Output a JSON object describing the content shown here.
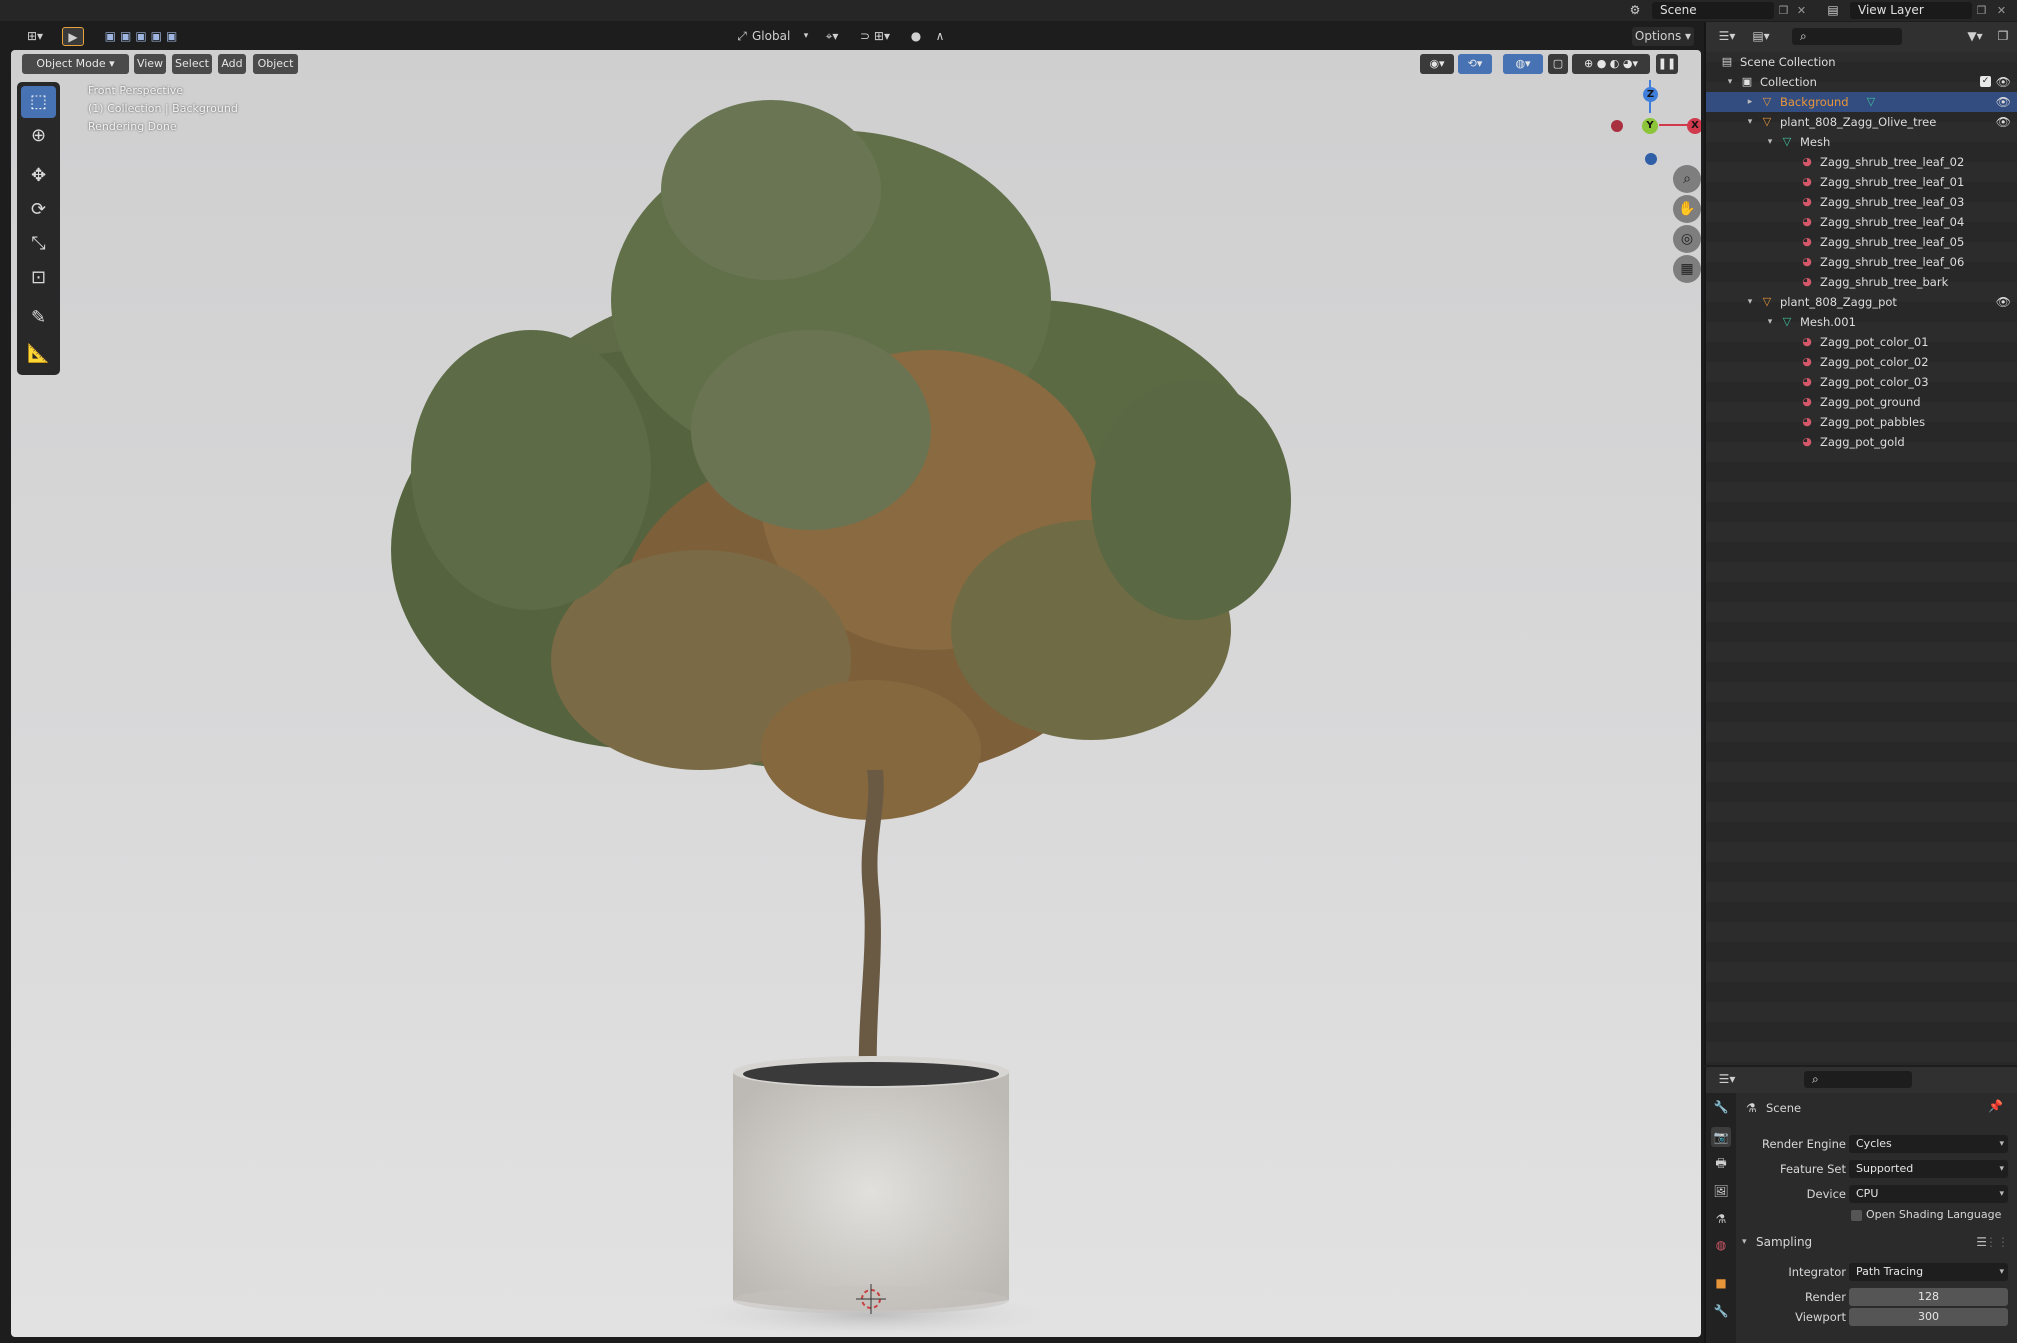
{
  "topbar": {
    "scene_label": "Scene",
    "view_layer_label": "View Layer"
  },
  "header": {
    "transform_orientation": "Global",
    "options_label": "Options"
  },
  "viewport": {
    "mode": "Object Mode",
    "menus": [
      "View",
      "Select",
      "Add",
      "Object"
    ],
    "info_lines": [
      "Front Perspective",
      "(1) Collection | Background",
      "Rendering Done"
    ],
    "gizmo_axes": {
      "z": "Z",
      "y": "Y",
      "x": "X"
    }
  },
  "outliner": {
    "rows": [
      {
        "label": "Scene Collection",
        "depth": 0,
        "icon": "scene-collection-icon",
        "arrow": "",
        "eye": false,
        "selected": false
      },
      {
        "label": "Collection",
        "depth": 1,
        "icon": "collection-icon",
        "arrow": "▾",
        "eye": true,
        "selected": false,
        "checkbox": true
      },
      {
        "label": "Background",
        "depth": 2,
        "icon": "object-icon",
        "arrow": "▸",
        "eye": true,
        "selected": true,
        "mesh_badge": true
      },
      {
        "label": "plant_808_Zagg_Olive_tree",
        "depth": 2,
        "icon": "object-icon",
        "arrow": "▾",
        "eye": true,
        "selected": false
      },
      {
        "label": "Mesh",
        "depth": 3,
        "icon": "mesh-icon",
        "arrow": "▾",
        "eye": false,
        "selected": false
      },
      {
        "label": "Zagg_shrub_tree_leaf_02",
        "depth": 4,
        "icon": "material-icon",
        "arrow": "",
        "eye": false,
        "selected": false
      },
      {
        "label": "Zagg_shrub_tree_leaf_01",
        "depth": 4,
        "icon": "material-icon",
        "arrow": "",
        "eye": false,
        "selected": false
      },
      {
        "label": "Zagg_shrub_tree_leaf_03",
        "depth": 4,
        "icon": "material-icon",
        "arrow": "",
        "eye": false,
        "selected": false
      },
      {
        "label": "Zagg_shrub_tree_leaf_04",
        "depth": 4,
        "icon": "material-icon",
        "arrow": "",
        "eye": false,
        "selected": false
      },
      {
        "label": "Zagg_shrub_tree_leaf_05",
        "depth": 4,
        "icon": "material-icon",
        "arrow": "",
        "eye": false,
        "selected": false
      },
      {
        "label": "Zagg_shrub_tree_leaf_06",
        "depth": 4,
        "icon": "material-icon",
        "arrow": "",
        "eye": false,
        "selected": false
      },
      {
        "label": "Zagg_shrub_tree_bark",
        "depth": 4,
        "icon": "material-icon",
        "arrow": "",
        "eye": false,
        "selected": false
      },
      {
        "label": "plant_808_Zagg_pot",
        "depth": 2,
        "icon": "object-icon",
        "arrow": "▾",
        "eye": true,
        "selected": false
      },
      {
        "label": "Mesh.001",
        "depth": 3,
        "icon": "mesh-icon",
        "arrow": "▾",
        "eye": false,
        "selected": false
      },
      {
        "label": "Zagg_pot_color_01",
        "depth": 4,
        "icon": "material-icon",
        "arrow": "",
        "eye": false,
        "selected": false
      },
      {
        "label": "Zagg_pot_color_02",
        "depth": 4,
        "icon": "material-icon",
        "arrow": "",
        "eye": false,
        "selected": false
      },
      {
        "label": "Zagg_pot_color_03",
        "depth": 4,
        "icon": "material-icon",
        "arrow": "",
        "eye": false,
        "selected": false
      },
      {
        "label": "Zagg_pot_ground",
        "depth": 4,
        "icon": "material-icon",
        "arrow": "",
        "eye": false,
        "selected": false
      },
      {
        "label": "Zagg_pot_pabbles",
        "depth": 4,
        "icon": "material-icon",
        "arrow": "",
        "eye": false,
        "selected": false
      },
      {
        "label": "Zagg_pot_gold",
        "depth": 4,
        "icon": "material-icon",
        "arrow": "",
        "eye": false,
        "selected": false
      }
    ]
  },
  "properties": {
    "context": "Scene",
    "render_engine_label": "Render Engine",
    "render_engine": "Cycles",
    "feature_set_label": "Feature Set",
    "feature_set": "Supported",
    "device_label": "Device",
    "device": "CPU",
    "osl_label": "Open Shading Language",
    "sampling_label": "Sampling",
    "integrator_label": "Integrator",
    "integrator": "Path Tracing",
    "render_label": "Render",
    "render_samples": "128",
    "viewport_label": "Viewport",
    "viewport_samples": "300"
  },
  "colors": {
    "accent": "#4772b3",
    "selected_row": "#334d80",
    "axis_x": "#d13a4c",
    "axis_y": "#8cc43a",
    "axis_z": "#3f7fdb",
    "object_icon": "#e8963a",
    "mesh_icon": "#3fc4a0",
    "material_icon": "#d4586a"
  }
}
